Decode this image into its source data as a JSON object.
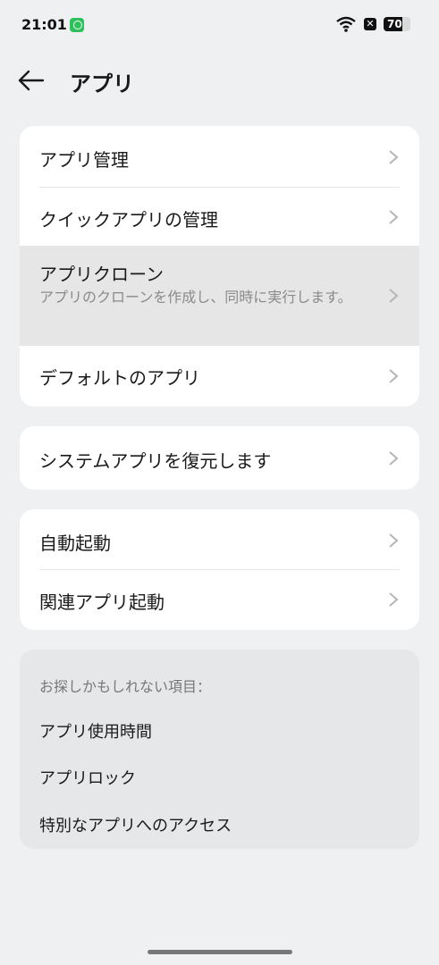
{
  "status_bar": {
    "time": "21:01",
    "battery_level": "70",
    "battery_fraction": 0.7
  },
  "header": {
    "title": "アプリ"
  },
  "group1": {
    "items": [
      {
        "label": "アプリ管理"
      },
      {
        "label": "クイックアプリの管理"
      },
      {
        "label": "アプリクローン",
        "subtitle": "アプリのクローンを作成し、同時に実行します。"
      },
      {
        "label": "デフォルトのアプリ"
      }
    ]
  },
  "group2": {
    "items": [
      {
        "label": "システムアプリを復元します"
      }
    ]
  },
  "group3": {
    "items": [
      {
        "label": "自動起動"
      },
      {
        "label": "関連アプリ起動"
      }
    ]
  },
  "suggestions": {
    "heading": "お探しかもしれない項目：",
    "items": [
      {
        "label": "アプリ使用時間"
      },
      {
        "label": "アプリロック"
      },
      {
        "label": "特別なアプリへのアクセス"
      }
    ]
  },
  "colors": {
    "background": "#eff0f2",
    "card": "#ffffff",
    "highlight": "#e6e6e7",
    "notification_green": "#2cc15b"
  }
}
